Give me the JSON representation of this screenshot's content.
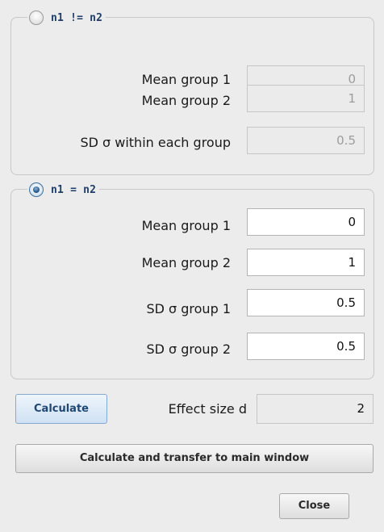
{
  "groups": [
    {
      "title": "n1 != n2",
      "selected": false,
      "fields": [
        {
          "label": "Mean group 1",
          "value": "0"
        },
        {
          "label": "Mean group 2",
          "value": "1"
        },
        {
          "label": "SD σ within each group",
          "value": "0.5"
        }
      ]
    },
    {
      "title": "n1 = n2",
      "selected": true,
      "fields": [
        {
          "label": "Mean group 1",
          "value": "0"
        },
        {
          "label": "Mean group 2",
          "value": "1"
        },
        {
          "label": "SD σ group 1",
          "value": "0.5"
        },
        {
          "label": "SD σ group 2",
          "value": "0.5"
        }
      ]
    }
  ],
  "actions": {
    "calculate_label": "Calculate",
    "effect_label": "Effect size d",
    "effect_value": "2",
    "transfer_label": "Calculate and transfer to main window",
    "close_label": "Close"
  }
}
